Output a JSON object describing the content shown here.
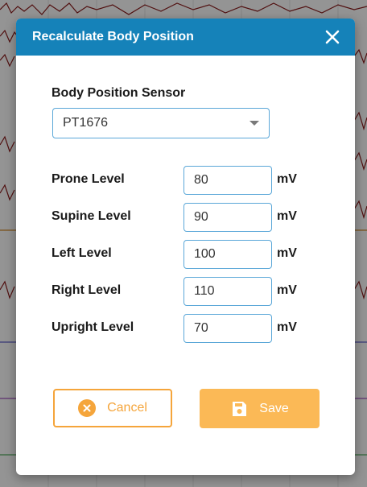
{
  "dialog": {
    "title": "Recalculate Body Position",
    "close_icon": "close-icon"
  },
  "sensor": {
    "label": "Body Position Sensor",
    "selected": "PT1676",
    "icon": "chevron-down-icon"
  },
  "levels": [
    {
      "label": "Prone Level",
      "value": "80",
      "unit": "mV"
    },
    {
      "label": "Supine Level",
      "value": "90",
      "unit": "mV"
    },
    {
      "label": "Left Level",
      "value": "100",
      "unit": "mV"
    },
    {
      "label": "Right Level",
      "value": "110",
      "unit": "mV"
    },
    {
      "label": "Upright Level",
      "value": "70",
      "unit": "mV"
    }
  ],
  "buttons": {
    "cancel": {
      "label": "Cancel",
      "icon": "cancel-circle-icon"
    },
    "save": {
      "label": "Save",
      "icon": "floppy-disk-icon"
    }
  },
  "colors": {
    "header": "#1582b9",
    "input_border": "#5aa7d8",
    "accent_orange": "#f5a53b",
    "save_bg": "#fbb956"
  }
}
